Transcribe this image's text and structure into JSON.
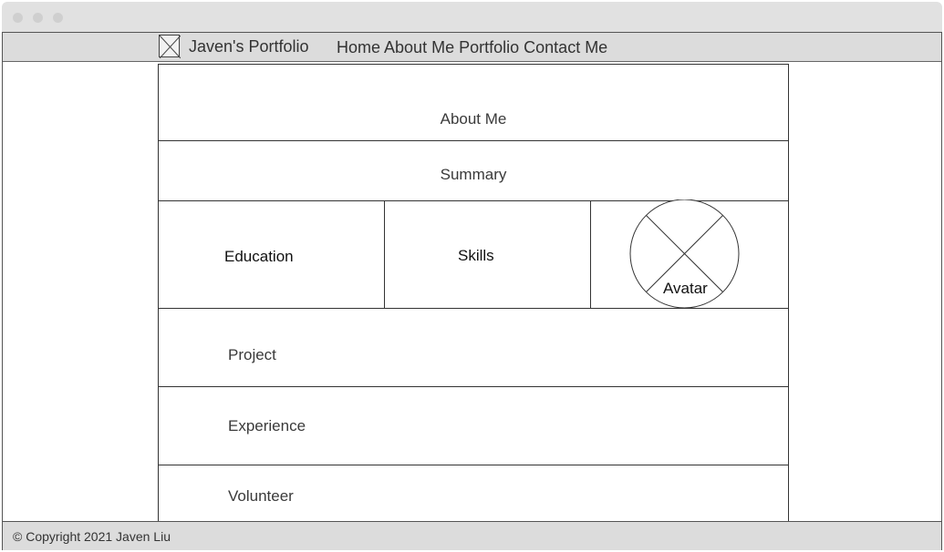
{
  "nav": {
    "brand": "Javen's Portfolio",
    "links": [
      "Home",
      "About Me",
      "Portfolio",
      "Contact Me"
    ]
  },
  "sections": {
    "about_me": "About Me",
    "summary": "Summary",
    "education": "Education",
    "skills": "Skills",
    "avatar": "Avatar",
    "project": "Project",
    "experience": "Experience",
    "volunteer": "Volunteer"
  },
  "footer": {
    "copyright": "© Copyright 2021 Javen Liu"
  },
  "colors": {
    "chrome": "#e1e1e1",
    "bar": "#dcdcdc",
    "line": "#333333"
  }
}
